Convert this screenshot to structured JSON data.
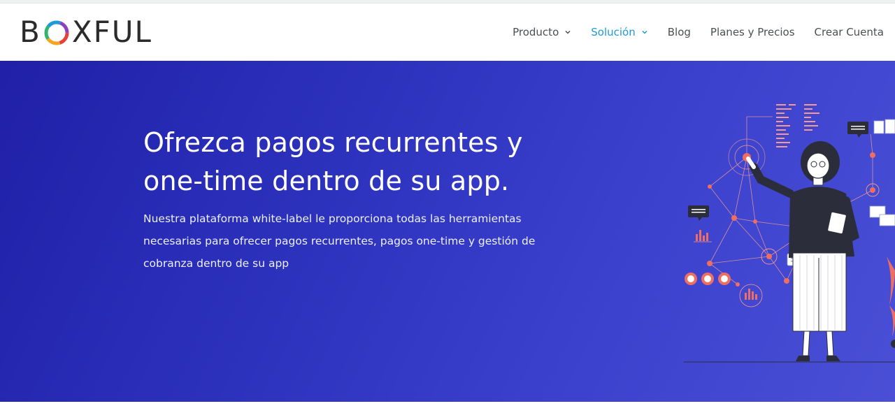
{
  "brand": {
    "logo_left": "B",
    "logo_right": "XFUL",
    "colors": [
      "#e8403a",
      "#f6a623",
      "#2fb66b",
      "#1e9ad6",
      "#8a3fc5"
    ]
  },
  "nav": {
    "items": [
      {
        "label": "Producto",
        "has_dropdown": true,
        "active": false
      },
      {
        "label": "Solución",
        "has_dropdown": true,
        "active": true
      },
      {
        "label": "Blog",
        "has_dropdown": false,
        "active": false
      },
      {
        "label": "Planes y Precios",
        "has_dropdown": false,
        "active": false
      },
      {
        "label": "Crear Cuenta",
        "has_dropdown": false,
        "active": false
      }
    ],
    "active_color": "#1e9ad6"
  },
  "hero": {
    "title_line1": "Ofrezca pagos recurrentes y",
    "title_line2": "one-time dentro de su app.",
    "subtitle_line1": "Nuestra plataforma white-label le proporciona todas las herramientas",
    "subtitle_line2": "necesarias para ofrecer pagos recurrentes, pagos one-time y gestión de",
    "subtitle_line3": "cobranza dentro de su app",
    "illustration": "woman-network-illustration"
  }
}
